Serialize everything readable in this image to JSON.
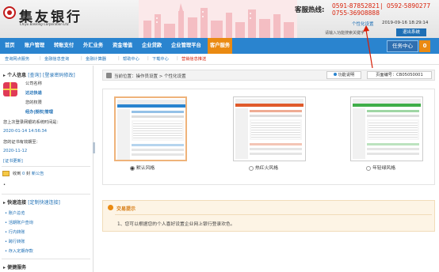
{
  "header": {
    "bank_name": "集友银行",
    "bank_name_en": "Chiyu Banking Corporation Ltd.",
    "hotline_label": "客服热线:",
    "hotline_1": "0591-87852821",
    "hotline_sep": "|",
    "hotline_2": "0592-5890277",
    "hotline_3": "0755-36908888",
    "personal_settings": "个性化设置",
    "datetime": "2019-09-16 18:29:14",
    "search_hint": "请输入功能搜索关键字",
    "logout": "退出系统"
  },
  "nav": {
    "items": [
      "首页",
      "账户管理",
      "转账支付",
      "外汇业务",
      "资金增值",
      "企业贷款",
      "企业管理平台",
      "客户服务"
    ],
    "active_index": 7,
    "task_center": "任务中心",
    "task_count": "0"
  },
  "subnav": {
    "items": [
      "查询网点服务",
      "金融信息查询",
      "金融计算器",
      "帮助中心",
      "下载中心",
      "营销信息推送"
    ],
    "separator": "|"
  },
  "sidebar": {
    "personal_info": {
      "title": "个人信息",
      "query": "[查询]",
      "change_password": "[登录密码修改]",
      "company_name": "公司名称",
      "company_value": "达达快递",
      "my_rights": "您的权限",
      "rights_value": "经办|授权|管理",
      "last_login_label": "您上次登录网银的系统时间是：",
      "last_login_value": "2020-01-14 14:56:34",
      "cert_expiry_label": "您的证书有效期至：",
      "cert_expiry_value": "2020-11-12",
      "cert_update": "[证书更新]"
    },
    "messages": {
      "received": "收到",
      "count": "0",
      "unit": "封",
      "new_notice": "新公告"
    },
    "quick_links": {
      "title": "快速连接",
      "customize": "[定制快速连接]",
      "items": [
        "账户总览",
        "活期账户查询",
        "行内转账",
        "跨行转账",
        "存入定期存款"
      ]
    },
    "convenience": {
      "title": "便捷服务"
    }
  },
  "main": {
    "breadcrumb": "当前位置：操作员设置 > 个性化设置",
    "func_desc": "功能说明",
    "page_number": "页面编号：CB05050001",
    "themes": [
      {
        "label": "默认风格",
        "selected": true,
        "color": "#2a84cf"
      },
      {
        "label": "热红火风格",
        "selected": false,
        "color": "#e05a2a"
      },
      {
        "label": "年轻绿风格",
        "selected": false,
        "color": "#3fae49"
      }
    ],
    "tips": {
      "title": "交易提示",
      "text": "1、您可以根据您的个人喜好设置企业网上银行登录欢色。"
    }
  },
  "colors": {
    "nav_bg": "#2a84cf",
    "accent_orange": "#ea8a12",
    "link_blue": "#1e6fb5",
    "hotline_red": "#d81e06"
  }
}
